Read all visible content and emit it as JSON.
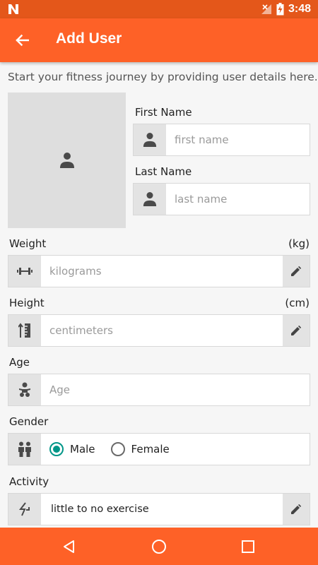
{
  "status_bar": {
    "time": "3:48",
    "icons": [
      "n-notification-icon",
      "signal-off-icon",
      "battery-charging-icon"
    ]
  },
  "toolbar": {
    "title": "Add User",
    "back_icon": "arrow-back-icon"
  },
  "intro_text": "Start your fitness journey by providing user details here.",
  "photo": {
    "icon": "person-icon"
  },
  "first_name": {
    "label": "First Name",
    "placeholder": "first name",
    "value": "",
    "icon": "person-icon"
  },
  "last_name": {
    "label": "Last Name",
    "placeholder": "last name",
    "value": "",
    "icon": "person-icon"
  },
  "weight": {
    "label": "Weight",
    "unit": "(kg)",
    "placeholder": "kilograms",
    "value": "",
    "icon": "dumbbell-icon",
    "edit_icon": "pencil-icon"
  },
  "height": {
    "label": "Height",
    "unit": "(cm)",
    "placeholder": "centimeters",
    "value": "",
    "icon": "ruler-icon",
    "edit_icon": "pencil-icon"
  },
  "age": {
    "label": "Age",
    "placeholder": "Age",
    "value": "",
    "icon": "baby-icon"
  },
  "gender": {
    "label": "Gender",
    "icon": "people-icon",
    "options": [
      {
        "label": "Male",
        "checked": true
      },
      {
        "label": "Female",
        "checked": false
      }
    ]
  },
  "activity": {
    "label": "Activity",
    "value": "little to no exercise",
    "icon": "activity-icon",
    "edit_icon": "pencil-icon"
  },
  "nav": {
    "icons": [
      "back-triangle-icon",
      "home-circle-icon",
      "recents-square-icon"
    ]
  },
  "colors": {
    "toolbar": "#fe6127",
    "status_bar": "#e4571a",
    "accent": "#009688",
    "icon_bg": "#e3e3e3"
  }
}
